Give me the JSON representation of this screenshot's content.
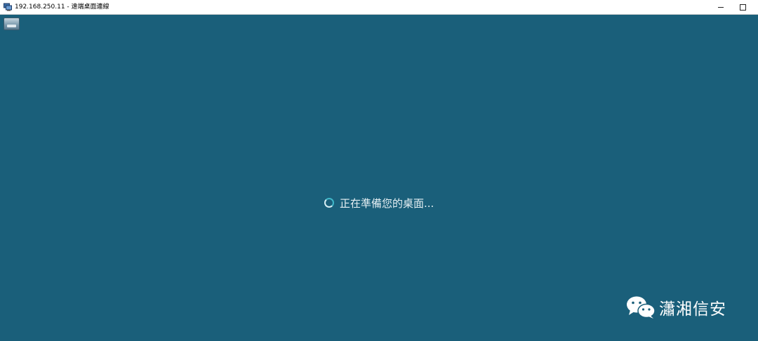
{
  "window": {
    "title": "192.168.250.11 - 遠端桌面連線",
    "minimize_label": "",
    "maximize_label": ""
  },
  "desktop": {
    "background_color": "#1a5f7a",
    "status_text": "正在準備您的桌面..."
  },
  "watermark": {
    "text": "瀟湘信安",
    "icon": "wechat-icon"
  }
}
